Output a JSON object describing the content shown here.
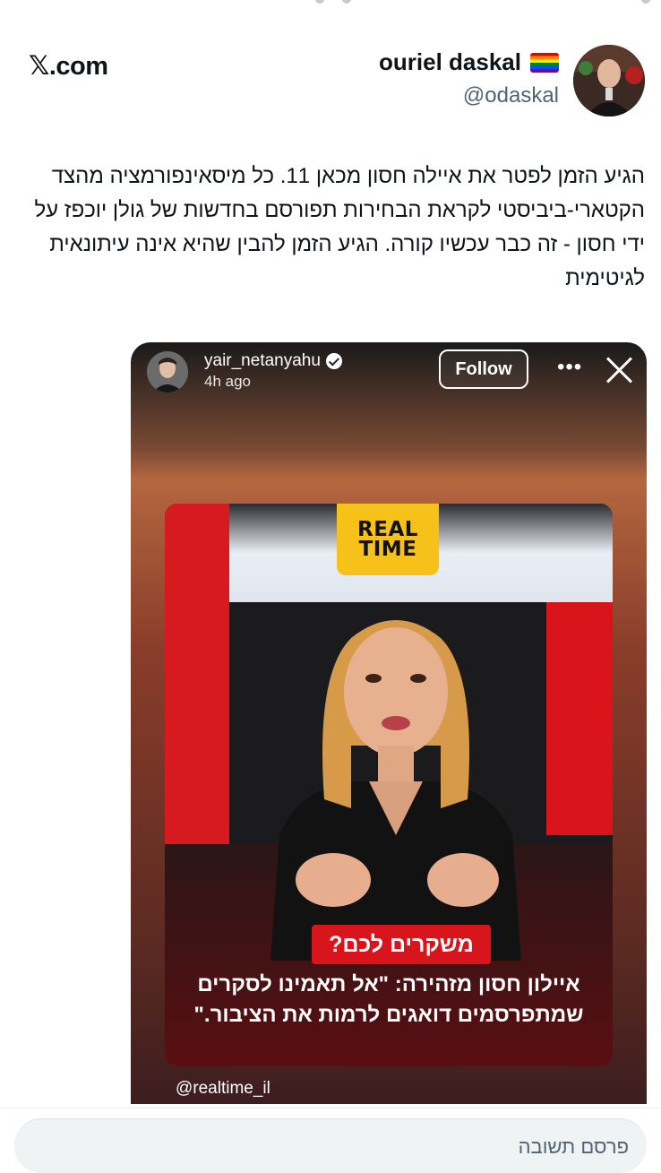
{
  "header": {
    "brand": "𝕏.com"
  },
  "author": {
    "name": "ouriel daskal",
    "handle": "@odaskal"
  },
  "tweet": {
    "text": "הגיע הזמן לפטר את איילה חסון מכאן 11. כל מיסאינפורמציה מהצד הקטארי-ביביסטי לקראת הבחירות תפורסם בחדשות של גולן יוכפז על ידי חסון - זה כבר עכשיו קורה. הגיע הזמן להבין שהיא אינה עיתונאית לגיטימית"
  },
  "embed": {
    "username": "yair_netanyahu",
    "time_ago": "4h ago",
    "follow_label": "Follow",
    "more_label": "•••",
    "logo_line1": "REAL",
    "logo_line2": "TIME",
    "banner": "משקרים לכם?",
    "caption_line1": "איילון חסון מזהירה: \"אל תאמינו לסקרים",
    "caption_line2": "שמתפרסמים דואגים לרמות את הציבור.\"",
    "source_handle": "@realtime_il"
  },
  "reply": {
    "placeholder": "פרסם תשובה"
  },
  "colors": {
    "text": "#0f1419",
    "secondary": "#536471",
    "brand_red": "#d71920",
    "logo_yellow": "#f6c21a"
  }
}
